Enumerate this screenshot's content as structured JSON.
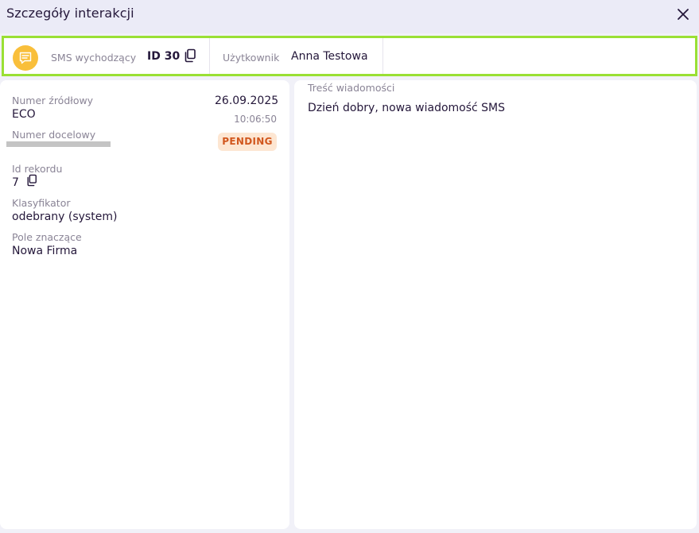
{
  "header": {
    "title": "Szczegóły interakcji",
    "close_icon": "close-icon"
  },
  "info_bar": {
    "type_icon": "sms-icon",
    "type_label": "SMS wychodzący",
    "id": "ID 30",
    "user_label": "Użytkownik",
    "user_value": "Anna Testowa",
    "accent_color": "#9ae034",
    "badge_color": "#f9bf3b"
  },
  "details": {
    "source_label": "Numer źródłowy",
    "source_value": "ECO",
    "target_label": "Numer docelowy",
    "date": "26.09.2025",
    "time": "10:06:50",
    "status": "PENDING",
    "status_color": "#d1571e",
    "record_label": "Id rekordu",
    "record_value": "7",
    "classifier_label": "Klasyfikator",
    "classifier_value": "odebrany (system)",
    "field_label": "Pole znaczące",
    "field_value": "Nowa Firma"
  },
  "message": {
    "label": "Treść wiadomości",
    "body": "Dzień dobry, nowa wiadomość SMS"
  }
}
